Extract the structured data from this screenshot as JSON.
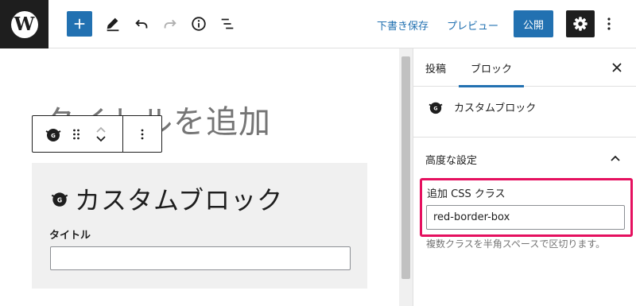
{
  "toolbar": {
    "logo_letter": "W",
    "save_draft": "下書き保存",
    "preview": "プレビュー",
    "publish": "公開"
  },
  "editor": {
    "title_placeholder": "タイトルを追加",
    "block_heading": "カスタムブロック",
    "title_field_label": "タイトル",
    "title_field_value": ""
  },
  "sidebar": {
    "tabs": [
      {
        "label": "投稿"
      },
      {
        "label": "ブロック",
        "active": true
      }
    ],
    "block_name": "カスタムブロック",
    "advanced_title": "高度な設定",
    "css_class_label": "追加 CSS クラス",
    "css_class_value": "red-border-box",
    "css_class_help": "複数クラスを半角スペースで区切ります。"
  },
  "colors": {
    "accent": "#2271b1",
    "dark": "#1e1e1e",
    "highlight": "#e5105f",
    "block_bg": "#f0f0f0"
  }
}
